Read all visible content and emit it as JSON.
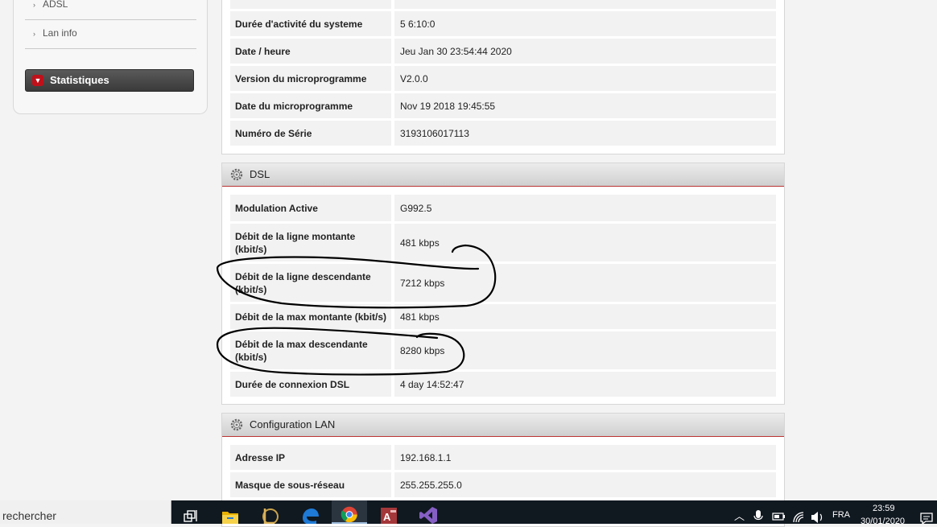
{
  "sidebar": {
    "links": [
      "ADSL",
      "Lan info"
    ],
    "active_section": "Statistiques"
  },
  "system": {
    "rows": [
      {
        "label": "Durée d'activité du systeme",
        "value": "5 6:10:0"
      },
      {
        "label": "Date / heure",
        "value": "Jeu Jan 30 23:54:44 2020"
      },
      {
        "label": "Version du microprogramme",
        "value": "V2.0.0"
      },
      {
        "label": "Date du microprogramme",
        "value": "Nov 19 2018 19:45:55"
      },
      {
        "label": "Numéro de Série",
        "value": "3193106017113"
      }
    ]
  },
  "dsl": {
    "title": "DSL",
    "rows": [
      {
        "label": "Modulation Active",
        "value": "G992.5"
      },
      {
        "label": "Débit de la ligne montante (kbit/s)",
        "value": "481 kbps"
      },
      {
        "label": "Débit de la ligne descendante (kbit/s)",
        "value": "7212 kbps"
      },
      {
        "label": "Débit de la max montante (kbit/s)",
        "value": "481 kbps"
      },
      {
        "label": "Débit de la max descendante (kbit/s)",
        "value": "8280 kbps"
      },
      {
        "label": "Durée de connexion DSL",
        "value": "4 day 14:52:47"
      }
    ]
  },
  "lan": {
    "title": "Configuration LAN",
    "rows": [
      {
        "label": "Adresse IP",
        "value": "192.168.1.1"
      },
      {
        "label": "Masque de sous-réseau",
        "value": "255.255.255.0"
      }
    ]
  },
  "taskbar": {
    "search_placeholder": "rechercher",
    "language": "FRA",
    "time": "23:59",
    "date": "30/01/2020",
    "apps": [
      "task-view",
      "file-explorer",
      "league-of-legends",
      "edge",
      "chrome",
      "access",
      "visual-studio"
    ]
  },
  "colors": {
    "accent_red": "#c0101a",
    "panel_header": "#d4d4d4",
    "taskbar": "#101820"
  }
}
